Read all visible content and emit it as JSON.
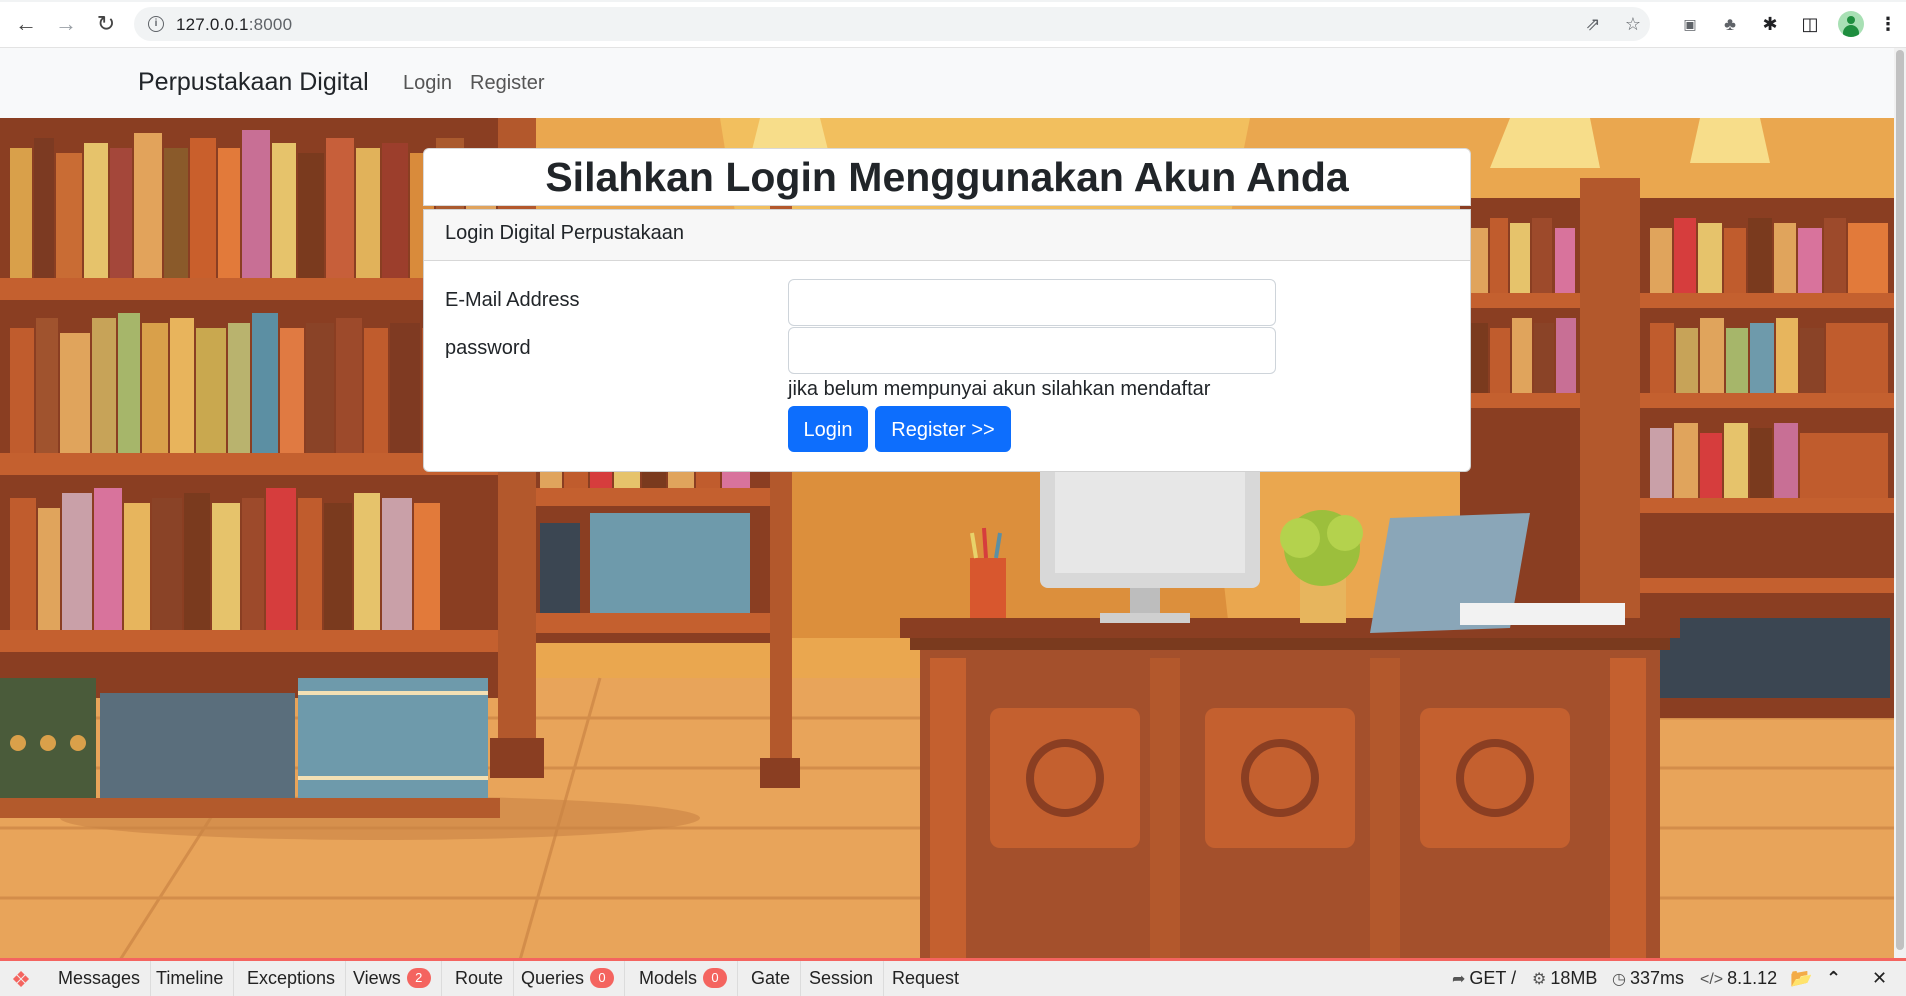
{
  "browser": {
    "url_host": "127.0.0.1",
    "url_port": ":8000",
    "icons": [
      "back-icon",
      "forward-icon",
      "reload-icon",
      "info-icon",
      "share-icon",
      "star-icon",
      "media-icon",
      "extension-icon",
      "puzzle-icon",
      "side-panel-icon",
      "profile-icon",
      "menu-icon"
    ]
  },
  "navbar": {
    "brand": "Perpustakaan Digital",
    "links": [
      "Login",
      "Register"
    ]
  },
  "login": {
    "title": "Silahkan Login Menggunakan Akun Anda",
    "card_header": "Login Digital Perpustakaan",
    "email_label": "E-Mail Address",
    "email_value": "",
    "password_label": "password",
    "password_value": "",
    "hint": "jika belum mempunyai akun silahkan mendaftar",
    "login_button": "Login",
    "register_button": "Register >>"
  },
  "debugbar": {
    "tabs": [
      {
        "label": "Messages"
      },
      {
        "label": "Timeline"
      },
      {
        "label": "Exceptions"
      },
      {
        "label": "Views",
        "badge": "2"
      },
      {
        "label": "Route"
      },
      {
        "label": "Queries",
        "badge": "0"
      },
      {
        "label": "Models",
        "badge": "0"
      },
      {
        "label": "Gate"
      },
      {
        "label": "Session"
      },
      {
        "label": "Request"
      }
    ],
    "method": "GET /",
    "memory": "18MB",
    "time": "337ms",
    "php_version": "8.1.12",
    "colors": {
      "accent": "#f4645f"
    }
  },
  "colors": {
    "primary_button": "#0d6efd",
    "navbar_bg": "#f8f9fa"
  }
}
